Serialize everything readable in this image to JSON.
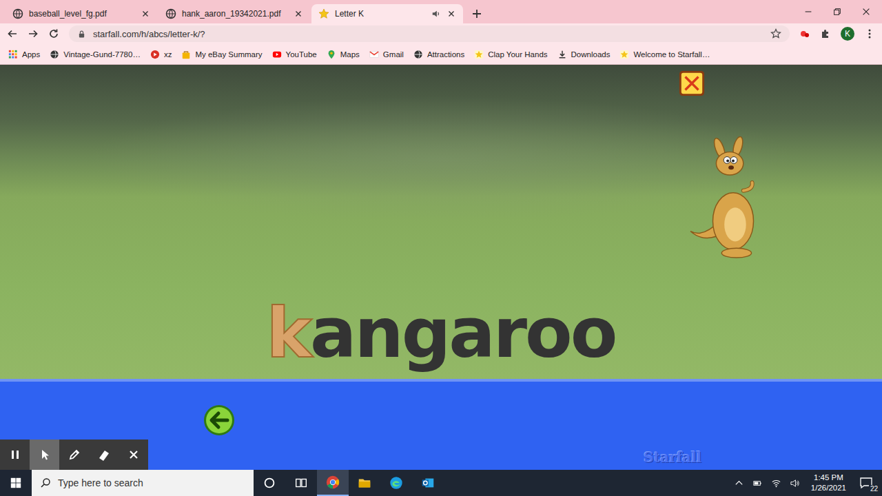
{
  "browser": {
    "tabs": [
      {
        "label": "baseball_level_fg.pdf",
        "kind": "pdf",
        "selected": false,
        "audio": false
      },
      {
        "label": "hank_aaron_19342021.pdf",
        "kind": "pdf",
        "selected": false,
        "audio": false
      },
      {
        "label": "Letter K",
        "kind": "starfall",
        "selected": true,
        "audio": true
      }
    ],
    "address": "starfall.com/h/abcs/letter-k/?",
    "profile": "K",
    "bookmarks": [
      {
        "label": "Apps",
        "kind": "apps"
      },
      {
        "label": "Vintage-Gund-7780…",
        "kind": "globe"
      },
      {
        "label": "xz",
        "kind": "red"
      },
      {
        "label": "My eBay Summary",
        "kind": "bag"
      },
      {
        "label": "YouTube",
        "kind": "youtube"
      },
      {
        "label": "Maps",
        "kind": "maps"
      },
      {
        "label": "Gmail",
        "kind": "gmail"
      },
      {
        "label": "Attractions",
        "kind": "globe"
      },
      {
        "label": "Clap Your Hands",
        "kind": "starfall"
      },
      {
        "label": "Downloads",
        "kind": "download"
      },
      {
        "label": "Welcome to Starfall…",
        "kind": "starfall"
      }
    ]
  },
  "page": {
    "word": [
      {
        "text": "k",
        "highlight": true
      },
      {
        "text": "angaroo",
        "highlight": false
      }
    ],
    "logo": "Starfall"
  },
  "annotation_tools": [
    {
      "kind": "pause",
      "selected": false
    },
    {
      "kind": "pointer",
      "selected": true
    },
    {
      "kind": "pen",
      "selected": false
    },
    {
      "kind": "eraser",
      "selected": false
    },
    {
      "kind": "close",
      "selected": false
    }
  ],
  "taskbar": {
    "search_placeholder": "Type here to search",
    "apps": [
      {
        "kind": "cortana",
        "selected": false
      },
      {
        "kind": "taskview",
        "selected": false
      },
      {
        "kind": "chrome",
        "selected": true
      },
      {
        "kind": "explorer",
        "selected": false
      },
      {
        "kind": "edge",
        "selected": false
      },
      {
        "kind": "outlook",
        "selected": false
      }
    ],
    "time": "1:45 PM",
    "date": "1/26/2021",
    "notifications": "22"
  }
}
